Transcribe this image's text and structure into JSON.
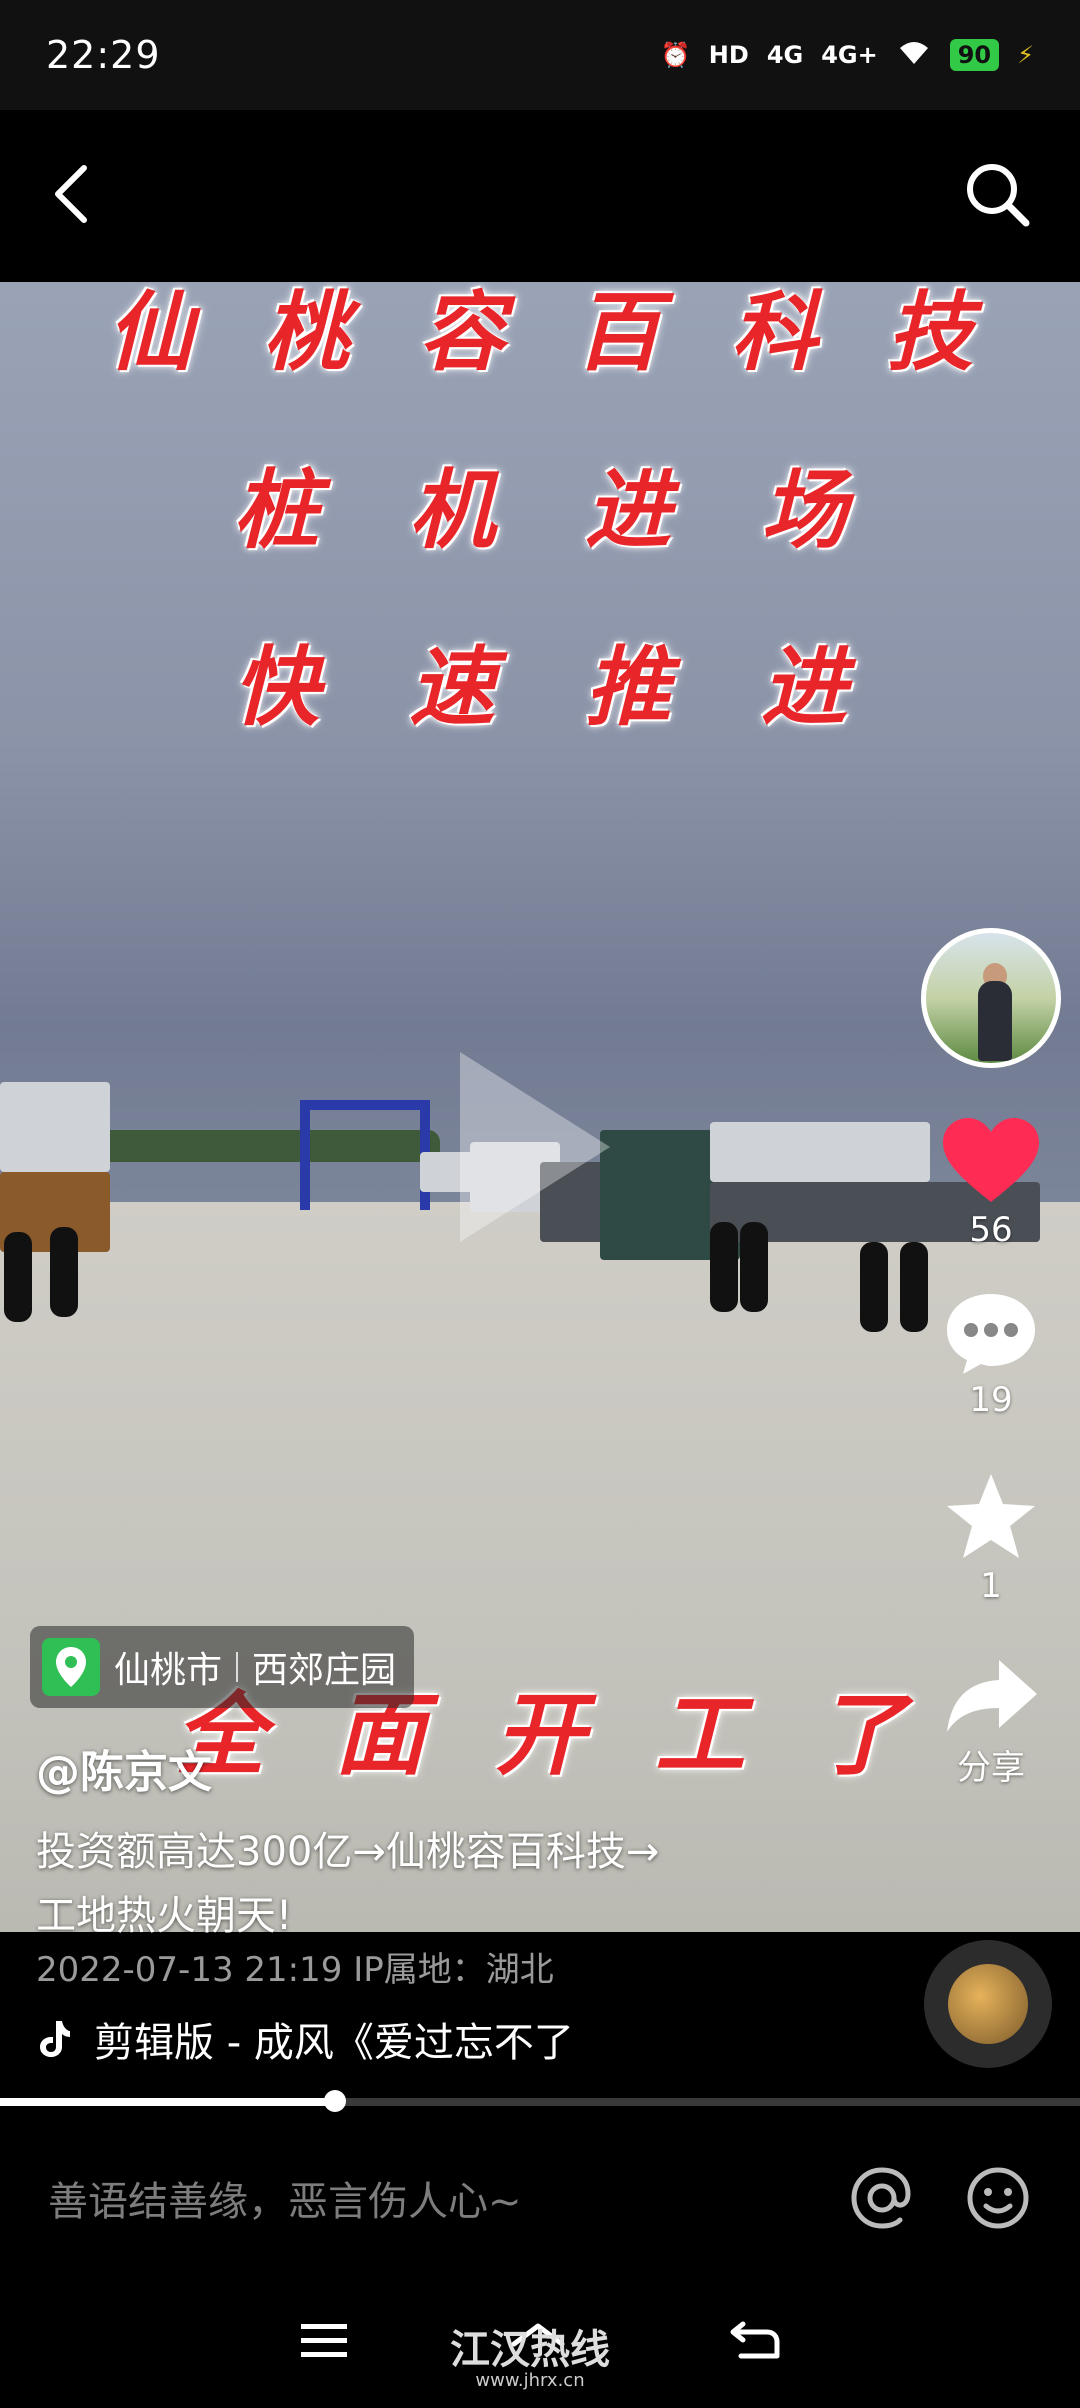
{
  "status_bar": {
    "time": "22:29",
    "hd": "HD",
    "net1": "4G",
    "net2": "4G+",
    "battery": "90"
  },
  "video_overlay": {
    "line1": [
      "仙",
      "桃",
      "容",
      "百",
      "科",
      "技"
    ],
    "line2": [
      "桩",
      "机",
      "进",
      "场"
    ],
    "line3": [
      "快",
      "速",
      "推",
      "进"
    ],
    "line4": [
      "全",
      "面",
      "开",
      "工",
      "了"
    ]
  },
  "actions": {
    "likes": "56",
    "comments": "19",
    "favorites": "1",
    "share_label": "分享"
  },
  "location": {
    "city": "仙桃市",
    "place": "西郊庄园"
  },
  "post": {
    "author": "@陈京文",
    "description_line1": "投资额高达300亿→仙桃容百科技→",
    "description_line2": "工地热火朝天!",
    "meta": "2022-07-13 21:19  IP属地：湖北"
  },
  "music": {
    "title": "剪辑版 - 成风《爱过忘不了"
  },
  "progress": {
    "fraction": 0.31
  },
  "comment_bar": {
    "placeholder": "善语结善缘，恶言伤人心~"
  },
  "watermark": {
    "title": "江汉热线",
    "url": "www.jhrx.cn"
  }
}
